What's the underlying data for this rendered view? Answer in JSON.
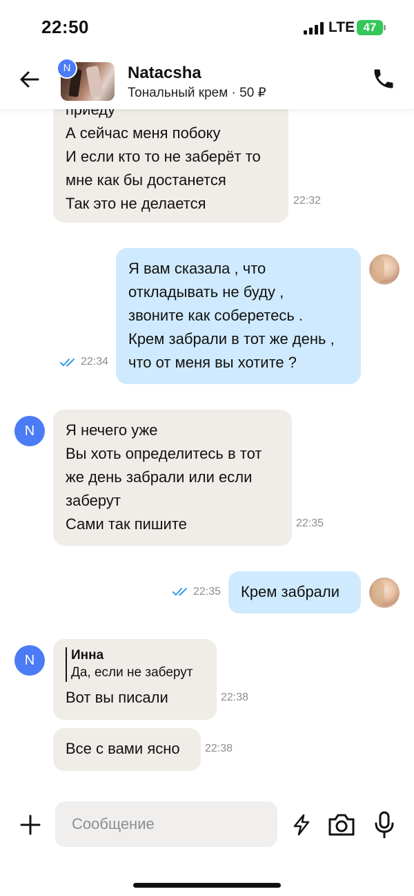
{
  "status_bar": {
    "time": "22:50",
    "network": "LTE",
    "battery": "47"
  },
  "header": {
    "avatar_initial": "N",
    "contact_name": "Natacsha",
    "listing": "Тональный крем · 50 ₽",
    "icons": {
      "back": "arrow-left-icon",
      "call": "phone-icon"
    }
  },
  "messages": [
    {
      "direction": "in",
      "text": "приеду\nА сейчас меня побоку\nИ если кто то не заберёт то\nмне как бы достанется\nТак это не делается",
      "time": "22:32"
    },
    {
      "direction": "out",
      "text": "Я вам сказала , что\nоткладывать не буду ,\nзвоните как соберетесь .\nКрем забрали в тот же день ,\nчто от меня вы хотите ?",
      "time": "22:34",
      "status": "read"
    },
    {
      "direction": "in",
      "avatar": "N",
      "text": "Я нечего уже\nВы хоть определитесь в тот\nже день забрали или если\nзаберут\nСами так пишите",
      "time": "22:35"
    },
    {
      "direction": "out",
      "text": "Крем забрали",
      "time": "22:35",
      "status": "read"
    },
    {
      "direction": "in",
      "avatar": "N",
      "reply_to": {
        "name": "Инна",
        "text": "Да, если не заберут"
      },
      "text": "Вот вы писали",
      "time": "22:38"
    },
    {
      "direction": "in",
      "text": "Все с вами ясно",
      "time": "22:38"
    }
  ],
  "input": {
    "placeholder": "Сообщение",
    "icons": [
      "plus-icon",
      "bolt-icon",
      "camera-icon",
      "microphone-icon"
    ]
  },
  "colors": {
    "incoming_bubble": "#f0ede8",
    "outgoing_bubble": "#cfeafe",
    "avatar_blue": "#4b7bf5",
    "read_check": "#2f9ae8",
    "battery_green": "#34c759"
  }
}
